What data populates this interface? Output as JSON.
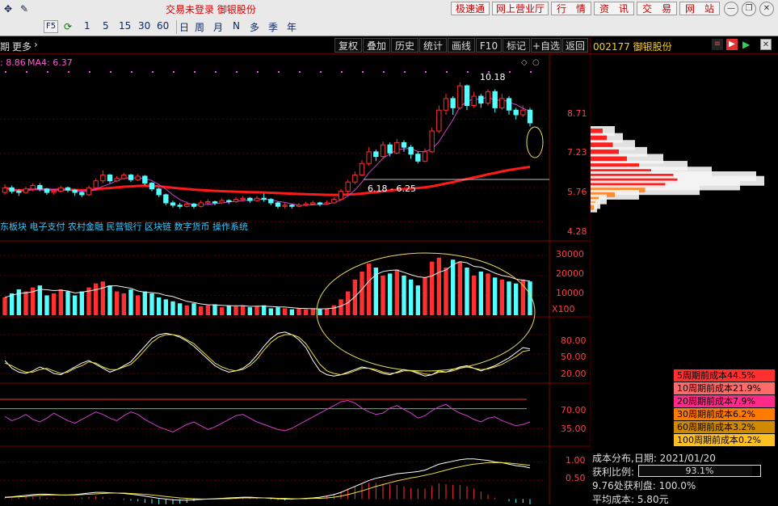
{
  "toolbar": {
    "title": "交易未登录  御银股份",
    "buttons": [
      "极速通",
      "网上营业厅",
      "行　情",
      "资　讯",
      "交　易",
      "网　站"
    ],
    "f5_label": "F5",
    "periods": [
      "1",
      "5",
      "15",
      "30",
      "60",
      "日",
      "周",
      "月",
      "N",
      "多",
      "季",
      "年"
    ]
  },
  "chart_toolbar": {
    "left_label": "期",
    "more_label": "更多",
    "buttons": [
      "复权",
      "叠加",
      "历史",
      "统计",
      "画线",
      "F10",
      "标记",
      "+自选",
      "返回"
    ]
  },
  "stock": {
    "code_name": "002177 御银股份"
  },
  "price_panel": {
    "ma_prefix": ": 8.86",
    "ma4_label": "MA4: 6.37",
    "high_label": "10.18",
    "range_label": "6.18 - 6.25",
    "sectors_label": "东板块 电子支付 农村金融 民营银行 区块链 数字货币 操作系统",
    "y_ticks": [
      "8.71",
      "7.23",
      "5.76",
      "4.28"
    ]
  },
  "volume_panel": {
    "y_ticks": [
      "30000",
      "20000",
      "10000"
    ],
    "unit_label": "X100"
  },
  "kdj_panel": {
    "y_ticks": [
      "80.00",
      "50.00",
      "20.00"
    ]
  },
  "rsi_panel": {
    "y_ticks": [
      "70.00",
      "35.00"
    ]
  },
  "macd_panel": {
    "y_ticks": [
      "1.00",
      "0.50"
    ]
  },
  "cost_legend": [
    {
      "label": "5周期前成本44.5%",
      "color": "#ff3030"
    },
    {
      "label": "10周期前成本21.9%",
      "color": "#ff6a6a"
    },
    {
      "label": "20周期前成本7.9%",
      "color": "#ff2a8a"
    },
    {
      "label": "30周期前成本6.2%",
      "color": "#ff7a00"
    },
    {
      "label": "60周期前成本3.2%",
      "color": "#d08a00"
    },
    {
      "label": "100周期前成本0.2%",
      "color": "#ffc020"
    }
  ],
  "cost_info": {
    "date_label": "成本分布,日期:  2021/01/20",
    "profit_ratio_label": "获利比例:",
    "profit_ratio_value": "93.1%",
    "profit_ratio_fraction": 0.931,
    "price_profit_label": "9.76处获利盘:  100.0%",
    "avg_cost_label": "平均成本:  5.80元"
  },
  "chart_data": {
    "type": "candlestick",
    "y_range": [
      3.6,
      11.2
    ],
    "price_ticks": [
      8.71,
      7.23,
      5.76,
      4.28
    ],
    "candles": [
      [
        5.55,
        5.75,
        5.45,
        5.9
      ],
      [
        5.75,
        5.6,
        5.5,
        5.85
      ],
      [
        5.6,
        5.55,
        5.4,
        5.7
      ],
      [
        5.55,
        5.7,
        5.5,
        5.8
      ],
      [
        5.7,
        5.85,
        5.6,
        5.95
      ],
      [
        5.85,
        5.7,
        5.6,
        5.95
      ],
      [
        5.7,
        5.55,
        5.45,
        5.75
      ],
      [
        5.55,
        5.6,
        5.45,
        5.7
      ],
      [
        5.6,
        5.75,
        5.55,
        5.85
      ],
      [
        5.75,
        5.65,
        5.55,
        5.8
      ],
      [
        5.65,
        5.55,
        5.4,
        5.7
      ],
      [
        5.55,
        5.45,
        5.35,
        5.6
      ],
      [
        5.45,
        5.75,
        5.4,
        5.85
      ],
      [
        5.75,
        6.05,
        5.7,
        6.15
      ],
      [
        6.05,
        6.3,
        5.95,
        6.5
      ],
      [
        6.3,
        6.05,
        5.95,
        6.35
      ],
      [
        6.05,
        6.15,
        6.0,
        6.25
      ],
      [
        6.15,
        6.3,
        6.1,
        6.4
      ],
      [
        6.3,
        6.1,
        6.0,
        6.35
      ],
      [
        6.1,
        6.25,
        6.05,
        6.35
      ],
      [
        6.25,
        5.95,
        5.85,
        6.3
      ],
      [
        5.95,
        5.7,
        5.6,
        6.0
      ],
      [
        5.7,
        5.45,
        5.35,
        5.75
      ],
      [
        5.45,
        5.1,
        5.0,
        5.5
      ],
      [
        5.1,
        5.0,
        4.9,
        5.2
      ],
      [
        5.0,
        4.95,
        4.85,
        5.1
      ],
      [
        4.95,
        5.05,
        4.9,
        5.15
      ],
      [
        5.05,
        4.95,
        4.85,
        5.1
      ],
      [
        4.95,
        5.1,
        4.9,
        5.2
      ],
      [
        5.1,
        5.15,
        5.0,
        5.25
      ],
      [
        5.15,
        5.1,
        5.0,
        5.2
      ],
      [
        5.1,
        5.2,
        5.05,
        5.3
      ],
      [
        5.2,
        5.15,
        5.05,
        5.25
      ],
      [
        5.15,
        5.25,
        5.1,
        5.35
      ],
      [
        5.25,
        5.3,
        5.15,
        5.4
      ],
      [
        5.3,
        5.2,
        5.1,
        5.35
      ],
      [
        5.2,
        5.3,
        5.15,
        5.4
      ],
      [
        5.3,
        5.25,
        5.15,
        5.5
      ],
      [
        5.25,
        5.1,
        5.0,
        5.3
      ],
      [
        5.1,
        4.95,
        4.85,
        5.15
      ],
      [
        4.95,
        5.0,
        4.85,
        5.1
      ],
      [
        5.0,
        4.95,
        4.85,
        5.05
      ],
      [
        4.95,
        5.0,
        4.9,
        5.1
      ],
      [
        5.0,
        5.05,
        4.95,
        5.15
      ],
      [
        5.05,
        5.1,
        5.0,
        5.2
      ],
      [
        5.1,
        5.05,
        4.95,
        5.15
      ],
      [
        5.05,
        5.1,
        5.0,
        5.2
      ],
      [
        5.1,
        5.25,
        5.05,
        5.35
      ],
      [
        5.25,
        5.6,
        5.2,
        5.7
      ],
      [
        5.6,
        6.0,
        5.5,
        6.1
      ],
      [
        6.0,
        6.3,
        5.9,
        6.45
      ],
      [
        6.3,
        6.8,
        6.25,
        6.95
      ],
      [
        6.8,
        7.3,
        6.7,
        7.5
      ],
      [
        7.3,
        7.1,
        6.9,
        7.4
      ],
      [
        7.1,
        7.6,
        7.0,
        7.75
      ],
      [
        7.6,
        7.25,
        7.1,
        7.7
      ],
      [
        7.25,
        7.7,
        7.2,
        7.85
      ],
      [
        7.7,
        7.5,
        7.3,
        7.8
      ],
      [
        7.5,
        7.2,
        7.0,
        7.6
      ],
      [
        7.2,
        6.9,
        6.8,
        7.3
      ],
      [
        6.9,
        7.3,
        6.85,
        7.45
      ],
      [
        7.3,
        8.2,
        7.25,
        8.35
      ],
      [
        8.2,
        9.1,
        8.1,
        9.3
      ],
      [
        9.1,
        9.6,
        8.9,
        9.8
      ],
      [
        9.6,
        9.2,
        8.9,
        9.7
      ],
      [
        9.2,
        10.15,
        9.1,
        10.3
      ],
      [
        10.15,
        9.3,
        9.1,
        10.2
      ],
      [
        9.3,
        9.7,
        9.2,
        9.9
      ],
      [
        9.7,
        9.4,
        9.2,
        9.8
      ],
      [
        9.4,
        9.9,
        9.3,
        10.0
      ],
      [
        9.9,
        9.2,
        9.0,
        10.0
      ],
      [
        9.2,
        9.6,
        9.1,
        9.8
      ],
      [
        9.6,
        9.1,
        8.9,
        9.7
      ],
      [
        9.1,
        8.9,
        8.7,
        9.2
      ],
      [
        8.9,
        9.1,
        8.8,
        9.3
      ],
      [
        9.1,
        8.55,
        8.4,
        9.2
      ]
    ],
    "volume_range": [
      0,
      35000
    ],
    "volume": [
      9000,
      11000,
      13000,
      12000,
      14000,
      15000,
      10000,
      11000,
      13000,
      12000,
      10000,
      12000,
      14000,
      16000,
      17000,
      15000,
      12000,
      11000,
      13000,
      10000,
      12000,
      11000,
      9000,
      8000,
      7000,
      6000,
      5000,
      6000,
      4500,
      5000,
      5500,
      4000,
      5000,
      4500,
      5000,
      4000,
      4500,
      5000,
      3500,
      4000,
      3500,
      3000,
      3500,
      3000,
      3500,
      3000,
      3500,
      5000,
      8000,
      12000,
      18000,
      22000,
      26000,
      24000,
      20000,
      21000,
      23000,
      20000,
      18000,
      15000,
      19000,
      27000,
      29000,
      24000,
      28000,
      27000,
      24000,
      20000,
      22000,
      21000,
      19000,
      18000,
      17000,
      16000,
      18000,
      17000
    ],
    "kdj_range": [
      10,
      100
    ],
    "kdj_k": [
      40,
      28,
      22,
      20,
      24,
      30,
      26,
      20,
      18,
      24,
      30,
      36,
      40,
      34,
      28,
      22,
      26,
      32,
      38,
      50,
      62,
      74,
      80,
      82,
      80,
      76,
      70,
      62,
      52,
      42,
      32,
      26,
      22,
      24,
      28,
      36,
      48,
      62,
      74,
      82,
      84,
      80,
      72,
      60,
      40,
      24,
      18,
      16,
      18,
      22,
      26,
      30,
      28,
      24,
      20,
      18,
      22,
      26,
      24,
      20,
      16,
      18,
      24,
      22,
      26,
      30,
      32,
      28,
      24,
      28,
      32,
      38,
      44,
      52,
      60,
      58
    ],
    "kdj_d": [
      36,
      32,
      26,
      22,
      22,
      26,
      28,
      24,
      20,
      22,
      28,
      32,
      38,
      36,
      30,
      26,
      26,
      30,
      34,
      44,
      56,
      68,
      76,
      80,
      80,
      78,
      72,
      66,
      56,
      46,
      36,
      30,
      26,
      24,
      26,
      32,
      42,
      56,
      68,
      76,
      80,
      80,
      76,
      66,
      50,
      34,
      24,
      20,
      18,
      20,
      24,
      28,
      28,
      26,
      22,
      20,
      21,
      24,
      24,
      22,
      19,
      18,
      22,
      22,
      24,
      28,
      30,
      28,
      26,
      27,
      30,
      34,
      40,
      46,
      54,
      56
    ],
    "rsi_range": [
      10,
      100
    ],
    "rsi_band": [
      67,
      82
    ],
    "rsi": [
      55,
      48,
      52,
      58,
      50,
      46,
      52,
      60,
      54,
      48,
      44,
      50,
      56,
      62,
      58,
      52,
      48,
      56,
      62,
      58,
      50,
      44,
      38,
      34,
      30,
      36,
      42,
      46,
      40,
      34,
      38,
      44,
      50,
      56,
      58,
      52,
      46,
      42,
      38,
      34,
      32,
      36,
      42,
      48,
      54,
      60,
      66,
      72,
      78,
      80,
      76,
      68,
      62,
      58,
      60,
      68,
      72,
      66,
      60,
      52,
      56,
      64,
      70,
      74,
      66,
      60,
      56,
      50,
      46,
      52,
      54,
      48,
      44,
      40,
      42,
      46
    ],
    "macd_range": [
      -0.1,
      1.25
    ],
    "macd_ticks": [
      1.0,
      0.5
    ],
    "macd_dif": [
      0.05,
      0.06,
      0.08,
      0.1,
      0.12,
      0.13,
      0.13,
      0.12,
      0.11,
      0.11,
      0.12,
      0.14,
      0.16,
      0.18,
      0.18,
      0.17,
      0.16,
      0.15,
      0.13,
      0.11,
      0.08,
      0.05,
      0.02,
      0.0,
      -0.02,
      -0.03,
      -0.03,
      -0.02,
      -0.01,
      0.0,
      0.01,
      0.02,
      0.03,
      0.04,
      0.05,
      0.05,
      0.04,
      0.03,
      0.02,
      0.01,
      0.0,
      0.0,
      0.01,
      0.02,
      0.03,
      0.05,
      0.08,
      0.12,
      0.18,
      0.26,
      0.34,
      0.42,
      0.5,
      0.56,
      0.6,
      0.64,
      0.68,
      0.7,
      0.72,
      0.74,
      0.78,
      0.86,
      0.94,
      0.98,
      1.02,
      1.06,
      1.08,
      1.08,
      1.06,
      1.04,
      1.0,
      0.98,
      0.94,
      0.9,
      0.88,
      0.84
    ],
    "macd_dea": [
      0.04,
      0.05,
      0.06,
      0.07,
      0.09,
      0.1,
      0.11,
      0.11,
      0.11,
      0.11,
      0.11,
      0.12,
      0.13,
      0.14,
      0.15,
      0.16,
      0.16,
      0.16,
      0.15,
      0.14,
      0.13,
      0.11,
      0.09,
      0.07,
      0.05,
      0.03,
      0.02,
      0.01,
      0.0,
      0.0,
      0.0,
      0.01,
      0.01,
      0.02,
      0.03,
      0.03,
      0.03,
      0.03,
      0.03,
      0.02,
      0.02,
      0.01,
      0.01,
      0.01,
      0.02,
      0.02,
      0.03,
      0.05,
      0.08,
      0.12,
      0.17,
      0.22,
      0.28,
      0.34,
      0.39,
      0.44,
      0.49,
      0.53,
      0.57,
      0.6,
      0.64,
      0.68,
      0.73,
      0.78,
      0.83,
      0.87,
      0.91,
      0.94,
      0.96,
      0.98,
      0.98,
      0.98,
      0.97,
      0.95,
      0.93,
      0.91
    ],
    "cost_profile": [
      {
        "price": 8.2,
        "w": 30
      },
      {
        "price": 7.9,
        "w": 40
      },
      {
        "price": 7.6,
        "w": 55
      },
      {
        "price": 7.3,
        "w": 70
      },
      {
        "price": 7.0,
        "w": 90
      },
      {
        "price": 6.7,
        "w": 120
      },
      {
        "price": 6.45,
        "w": 150
      },
      {
        "price": 6.25,
        "w": 205
      },
      {
        "price": 6.05,
        "w": 215
      },
      {
        "price": 5.85,
        "w": 185
      },
      {
        "price": 5.65,
        "w": 135
      },
      {
        "price": 5.45,
        "w": 60
      },
      {
        "price": 5.25,
        "w": 20
      },
      {
        "price": 5.05,
        "w": 12
      },
      {
        "price": 4.9,
        "w": 8
      }
    ]
  }
}
